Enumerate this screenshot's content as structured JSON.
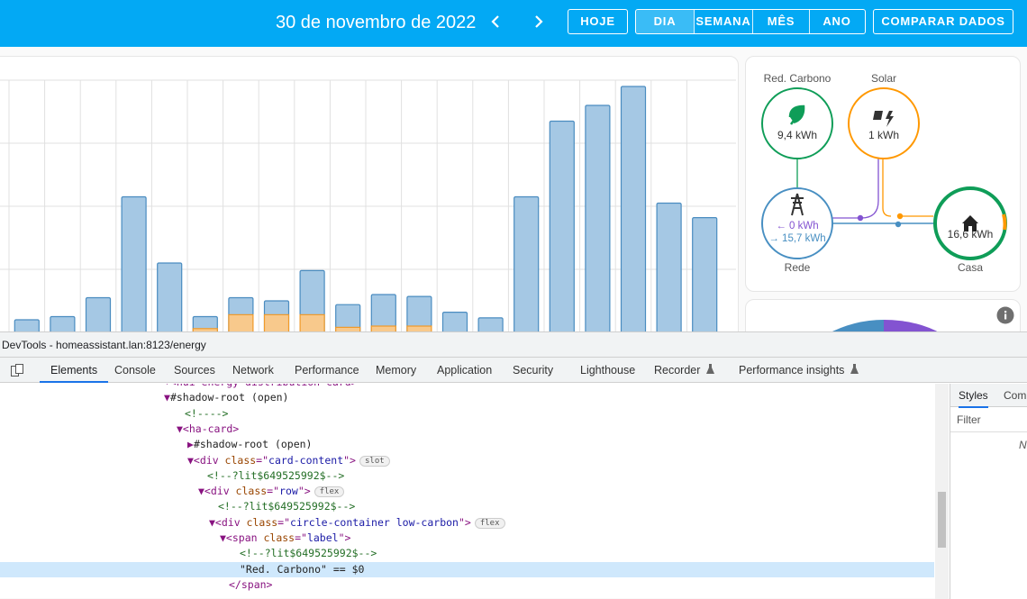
{
  "header": {
    "date": "30 de novembro de 2022",
    "prev_icon": "chevron-left-icon",
    "next_icon": "chevron-right-icon",
    "today": "HOJE",
    "periods": [
      "DIA",
      "SEMANA",
      "MÊS",
      "ANO"
    ],
    "compare": "COMPARAR DADOS"
  },
  "chart_data": {
    "type": "bar",
    "series": [
      {
        "name": "",
        "color": "#a5c8e4",
        "values": [
          0.2,
          0.25,
          0.55,
          2.15,
          1.1,
          0.25,
          0.55,
          0.5,
          0.98,
          0.44,
          0.6,
          0.57,
          0.32,
          0.23,
          2.15,
          3.35,
          3.6,
          3.9,
          2.05,
          1.82
        ]
      },
      {
        "name": "",
        "color": "#f8c98c",
        "values": [
          0,
          0,
          0,
          0,
          0,
          0.06,
          0.28,
          0.28,
          0.28,
          0.08,
          0.1,
          0.1,
          0,
          0,
          0,
          0,
          0,
          0,
          0,
          0
        ]
      }
    ],
    "ylim": [
      0,
      4
    ]
  },
  "distribution": {
    "low_carbon": {
      "label": "Red. Carbono",
      "value": "9,4 kWh",
      "icon": "leaf-icon"
    },
    "solar": {
      "label": "Solar",
      "value": "1 kWh",
      "icon": "solar-power-icon"
    },
    "grid": {
      "label": "Rede",
      "in": "← 0 kWh",
      "out": "→ 15,7 kWh",
      "icon": "transmission-tower-icon"
    },
    "home": {
      "label": "Casa",
      "value": "16,6 kWh",
      "icon": "home-icon"
    },
    "colors": {
      "low_carbon": "#0f9d58",
      "solar": "#ff9800",
      "grid": "#488fc2",
      "return": "#8353d1"
    }
  },
  "devtools": {
    "title": "DevTools - homeassistant.lan:8123/energy",
    "tabs": [
      "Elements",
      "Console",
      "Sources",
      "Network",
      "Performance",
      "Memory",
      "Application",
      "Security",
      "Lighthouse",
      "Recorder",
      "Performance insights"
    ],
    "side_tabs": [
      "Styles",
      "Com"
    ],
    "filter": "Filter",
    "side_letter": "N",
    "dom": [
      {
        "parts": [
          {
            "c": "tag",
            "t": "▾<hui-energy-distribution-card>"
          }
        ]
      },
      {
        "parts": [
          {
            "c": "tag",
            "t": "▼"
          },
          {
            "c": "txt",
            "t": "#shadow-root (open)"
          }
        ]
      },
      {
        "parts": [
          {
            "c": "cmt",
            "t": "<!---->"
          }
        ]
      },
      {
        "parts": [
          {
            "c": "tag",
            "t": "▼<ha-card>"
          }
        ]
      },
      {
        "parts": [
          {
            "c": "tag",
            "t": "▶"
          },
          {
            "c": "txt",
            "t": "#shadow-root (open)"
          }
        ]
      },
      {
        "parts": [
          {
            "c": "tag",
            "t": "▼<div "
          },
          {
            "c": "attr",
            "t": "class"
          },
          {
            "c": "tag",
            "t": "=\""
          },
          {
            "c": "val",
            "t": "card-content"
          },
          {
            "c": "tag",
            "t": "\">"
          }
        ],
        "badge": "slot"
      },
      {
        "parts": [
          {
            "c": "cmt",
            "t": "<!--?lit$649525992$-->"
          }
        ]
      },
      {
        "parts": [
          {
            "c": "tag",
            "t": "▼<div "
          },
          {
            "c": "attr",
            "t": "class"
          },
          {
            "c": "tag",
            "t": "=\""
          },
          {
            "c": "val",
            "t": "row"
          },
          {
            "c": "tag",
            "t": "\">"
          }
        ],
        "badge": "flex"
      },
      {
        "parts": [
          {
            "c": "cmt",
            "t": "<!--?lit$649525992$-->"
          }
        ]
      },
      {
        "parts": [
          {
            "c": "tag",
            "t": "▼<div "
          },
          {
            "c": "attr",
            "t": "class"
          },
          {
            "c": "tag",
            "t": "=\""
          },
          {
            "c": "val",
            "t": "circle-container low-carbon"
          },
          {
            "c": "tag",
            "t": "\">"
          }
        ],
        "badge": "flex"
      },
      {
        "parts": [
          {
            "c": "tag",
            "t": "▼<span "
          },
          {
            "c": "attr",
            "t": "class"
          },
          {
            "c": "tag",
            "t": "=\""
          },
          {
            "c": "val",
            "t": "label"
          },
          {
            "c": "tag",
            "t": "\">"
          }
        ]
      },
      {
        "parts": [
          {
            "c": "cmt",
            "t": "<!--?lit$649525992$-->"
          }
        ]
      },
      {
        "parts": [
          {
            "c": "txt",
            "t": "\"Red. Carbono\" == $0"
          }
        ],
        "selected": true
      },
      {
        "parts": [
          {
            "c": "tag",
            "t": "</span>"
          }
        ]
      }
    ]
  }
}
